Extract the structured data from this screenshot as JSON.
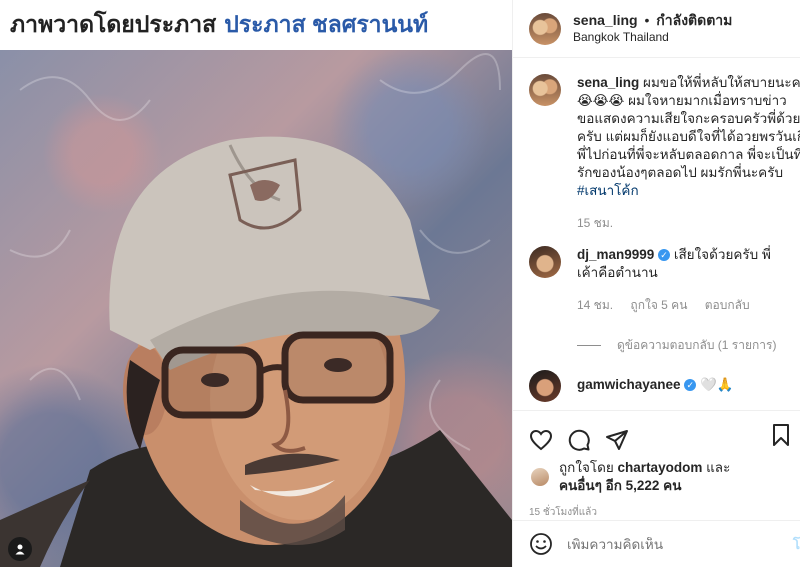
{
  "image_caption": {
    "part1": "ภาพวาดโดยประภาส",
    "part2": "ประภาส ชลศรานนท์"
  },
  "header": {
    "username": "sena_ling",
    "separator": "•",
    "follow_status": "กำลังติดตาม",
    "location": "Bangkok Thailand"
  },
  "caption": {
    "username": "sena_ling",
    "lines": [
      "ผมขอให้พี่หลับให้สบายนะครับ",
      "😭😭😭 ผมใจหายมากเมื่อทราบข่าว",
      "ขอแสดงความเสียใจกะครอบครัวพี่ด้วย",
      "ครับ แต่ผมก็ยังแอบดีใจที่ได้อวยพรวันเกิด",
      "พี่ไปก่อนที่พี่จะหลับตลอดกาล พี่จะเป็นที่",
      "รักของน้องๆตลอดไป ผมรักพี่นะครับ"
    ],
    "hashtag": "#เสนาโค้ก",
    "time": "15 ชม."
  },
  "comments": [
    {
      "username": "dj_man9999",
      "text": "เสียใจด้วยครับ พี่",
      "text2": "เค้าคือตำนาน",
      "time": "14 ชม.",
      "likes": "ถูกใจ 5 คน",
      "reply": "ตอบกลับ",
      "view_replies": "ดูข้อความตอบกลับ (1 รายการ)"
    },
    {
      "username": "gamwichayanee",
      "text": "🤍🙏"
    }
  ],
  "likes": {
    "liked_by": "ถูกใจโดย",
    "user": "chartayodom",
    "and": "และ",
    "others": "คนอื่นๆ อีก 5,222 คน"
  },
  "post_time": "15 ชั่วโมงที่แล้ว",
  "add_comment": {
    "placeholder": "เพิ่มความคิดเห็น",
    "post_label": "โพ"
  },
  "icons": {
    "heart": "heart-icon",
    "comment": "comment-icon",
    "share": "share-icon",
    "bookmark": "bookmark-icon",
    "emoji": "emoji-icon",
    "user": "user-tag-icon"
  }
}
